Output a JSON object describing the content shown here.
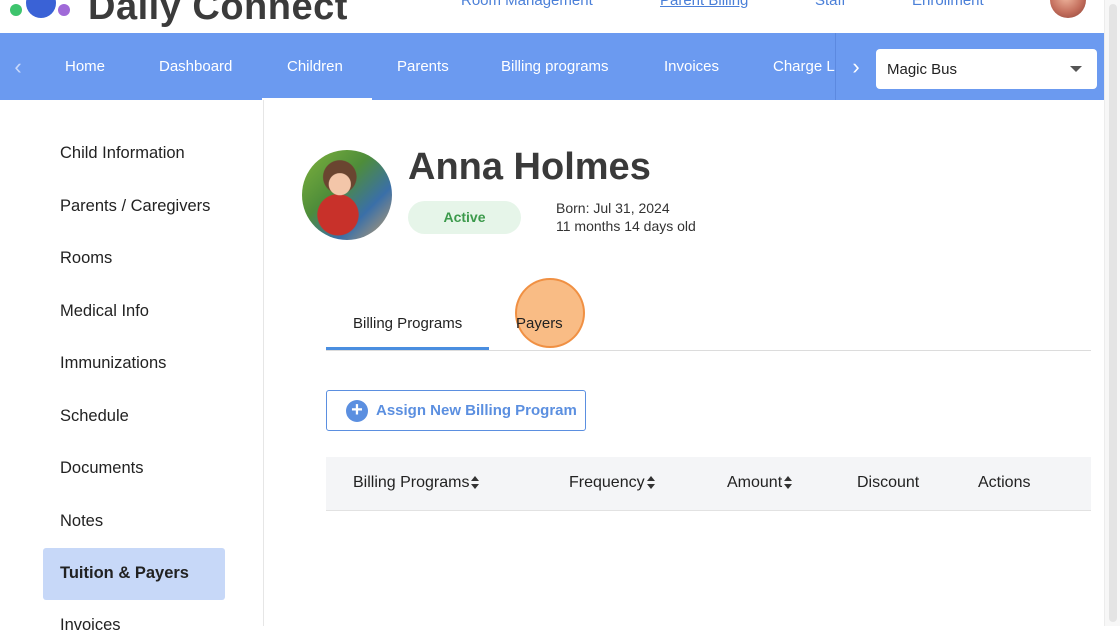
{
  "header": {
    "logo_text": "Daily Connect",
    "links": [
      "Room Management",
      "Parent Billing",
      "Staff",
      "Enrollment"
    ]
  },
  "nav": {
    "items": [
      "Home",
      "Dashboard",
      "Children",
      "Parents",
      "Billing programs",
      "Invoices",
      "Charge Lists"
    ],
    "active": "Children",
    "school_select": "Magic Bus"
  },
  "sidebar": {
    "items": [
      "Child Information",
      "Parents / Caregivers",
      "Rooms",
      "Medical Info",
      "Immunizations",
      "Schedule",
      "Documents",
      "Notes",
      "Tuition & Payers",
      "Invoices"
    ],
    "active": "Tuition & Payers"
  },
  "child": {
    "name": "Anna Holmes",
    "status": "Active",
    "born": "Born: Jul 31, 2024",
    "age": "11 months 14 days old"
  },
  "tabs": {
    "items": [
      "Billing Programs",
      "Payers"
    ],
    "active": "Billing Programs"
  },
  "assign_button": "Assign New Billing Program",
  "table": {
    "columns": [
      "Billing Programs",
      "Frequency",
      "Amount",
      "Discount",
      "Actions"
    ]
  },
  "colors": {
    "nav_bg": "#6b9af0",
    "accent": "#5b8fe0",
    "active_status": "#3c9a4c",
    "sidebar_active_bg": "#c7d8f8"
  }
}
